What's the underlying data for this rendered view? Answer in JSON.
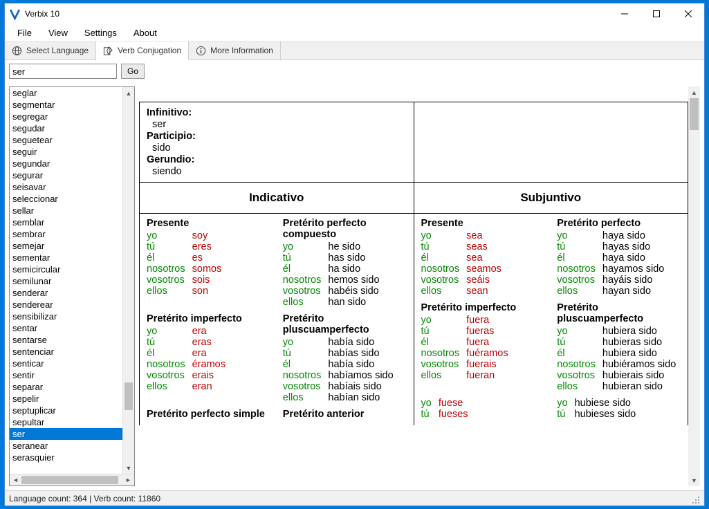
{
  "window": {
    "title": "Verbix 10"
  },
  "menu": {
    "file": "File",
    "view": "View",
    "settings": "Settings",
    "about": "About"
  },
  "tabs": {
    "select_language": "Select Language",
    "verb_conjugation": "Verb Conjugation",
    "more_info": "More Information"
  },
  "search": {
    "value": "ser",
    "go_label": "Go"
  },
  "verblist": {
    "items": [
      "seglar",
      "segmentar",
      "segregar",
      "segudar",
      "seguetear",
      "seguir",
      "segundar",
      "segurar",
      "seisavar",
      "seleccionar",
      "sellar",
      "semblar",
      "sembrar",
      "semejar",
      "sementar",
      "semicircular",
      "semilunar",
      "senderar",
      "senderear",
      "sensibilizar",
      "sentar",
      "sentarse",
      "sentenciar",
      "senticar",
      "sentir",
      "separar",
      "sepelir",
      "septuplicar",
      "sepultar",
      "ser",
      "seranear",
      "serasquier"
    ],
    "selected_index": 29
  },
  "info": {
    "infinitivo_label": "Infinitivo:",
    "infinitivo": "ser",
    "participio_label": "Participio:",
    "participio": "sido",
    "gerundio_label": "Gerundio:",
    "gerundio": "siendo"
  },
  "moods": {
    "indicativo": "Indicativo",
    "subjuntivo": "Subjuntivo"
  },
  "pronouns": [
    "yo",
    "tú",
    "él",
    "nosotros",
    "vosotros",
    "ellos"
  ],
  "indicativo": {
    "presente": {
      "title": "Presente",
      "forms": [
        "soy",
        "eres",
        "es",
        "somos",
        "sois",
        "son"
      ],
      "irregular": true
    },
    "pret_perf_comp": {
      "title": "Pretérito perfecto compuesto",
      "forms": [
        "he sido",
        "has sido",
        "ha sido",
        "hemos sido",
        "habéis sido",
        "han sido"
      ],
      "irregular": false
    },
    "pret_imperf": {
      "title": "Pretérito imperfecto",
      "forms": [
        "era",
        "eras",
        "era",
        "éramos",
        "erais",
        "eran"
      ],
      "irregular": true
    },
    "pret_plusc": {
      "title": "Pretérito pluscuamperfecto",
      "forms": [
        "había sido",
        "habías sido",
        "había sido",
        "habíamos sido",
        "habíais sido",
        "habían sido"
      ],
      "irregular": false
    },
    "pret_perf_simple": {
      "title": "Pretérito perfecto simple"
    },
    "pret_anterior": {
      "title": "Pretérito anterior"
    }
  },
  "subjuntivo": {
    "presente": {
      "title": "Presente",
      "forms": [
        "sea",
        "seas",
        "sea",
        "seamos",
        "seáis",
        "sean"
      ],
      "irregular": true
    },
    "pret_perf": {
      "title": "Pretérito perfecto",
      "forms": [
        "haya sido",
        "hayas sido",
        "haya sido",
        "hayamos sido",
        "hayáis sido",
        "hayan sido"
      ],
      "irregular": false
    },
    "pret_imperf": {
      "title": "Pretérito imperfecto",
      "forms": [
        "fuera",
        "fueras",
        "fuera",
        "fuéramos",
        "fuerais",
        "fueran"
      ],
      "irregular": true
    },
    "pret_plusc": {
      "title": "Pretérito pluscuamperfecto",
      "forms": [
        "hubiera sido",
        "hubieras sido",
        "hubiera sido",
        "hubiéramos sido",
        "hubierais sido",
        "hubieran sido"
      ],
      "irregular": false
    },
    "pret_imperf2": {
      "forms": [
        "fuese",
        "fueses"
      ],
      "pron": [
        "yo",
        "tú"
      ],
      "irregular": true
    },
    "pret_plusc2": {
      "forms": [
        "hubiese sido",
        "hubieses sido"
      ],
      "pron": [
        "yo",
        "tú"
      ],
      "irregular": false
    }
  },
  "status": {
    "text": "Language count: 364  |  Verb count: 11860"
  }
}
